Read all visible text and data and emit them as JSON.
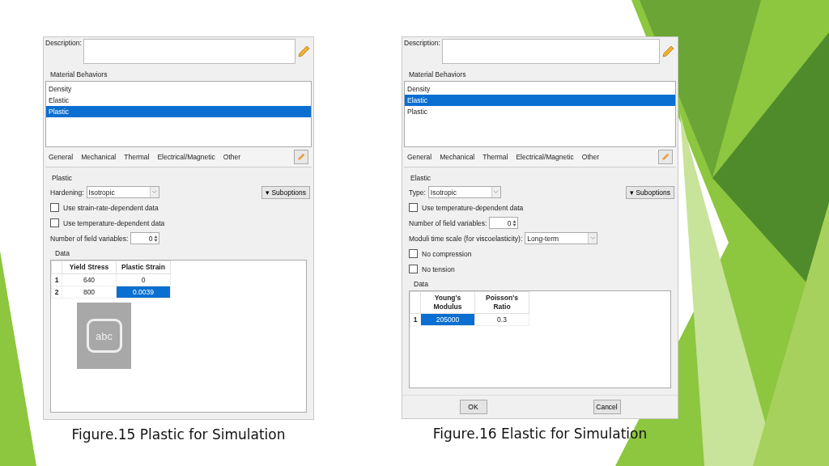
{
  "figures": [
    {
      "caption": "Figure.15 Plastic for Simulation",
      "dialog": {
        "description_label": "Description:",
        "behaviors_label": "Material Behaviors",
        "behaviors": [
          {
            "label": "Density",
            "selected": false
          },
          {
            "label": "Elastic",
            "selected": false
          },
          {
            "label": "Plastic",
            "selected": true
          }
        ],
        "menu": [
          "General",
          "Mechanical",
          "Thermal",
          "Electrical/Magnetic",
          "Other"
        ],
        "section_title": "Plastic",
        "suboptions": "▾ Suboptions",
        "options": [
          {
            "kind": "select",
            "label": "Hardening:",
            "value": "Isotropic"
          },
          {
            "kind": "checkbox",
            "label": "Use strain-rate-dependent data",
            "checked": false
          },
          {
            "kind": "checkbox",
            "label": "Use temperature-dependent data",
            "checked": false
          },
          {
            "kind": "spinner",
            "label": "Number of field variables:",
            "value": "0"
          }
        ],
        "data_label": "Data",
        "table": {
          "columns": [
            "Yield Stress",
            "Plastic Strain"
          ],
          "rows": [
            {
              "index": "1",
              "cells": [
                {
                  "text": "640",
                  "selected": false
                },
                {
                  "text": "0",
                  "selected": false
                }
              ]
            },
            {
              "index": "2",
              "cells": [
                {
                  "text": "800",
                  "selected": false
                },
                {
                  "text": "0.0039",
                  "selected": true
                }
              ]
            }
          ]
        },
        "overlay": {
          "label": "abc"
        }
      }
    },
    {
      "caption": "Figure.16 Elastic for Simulation",
      "dialog": {
        "description_label": "Description:",
        "behaviors_label": "Material Behaviors",
        "behaviors": [
          {
            "label": "Density",
            "selected": false
          },
          {
            "label": "Elastic",
            "selected": true
          },
          {
            "label": "Plastic",
            "selected": false
          }
        ],
        "menu": [
          "General",
          "Mechanical",
          "Thermal",
          "Electrical/Magnetic",
          "Other"
        ],
        "section_title": "Elastic",
        "suboptions": "▾ Suboptions",
        "options": [
          {
            "kind": "select",
            "label": "Type:",
            "value": "Isotropic"
          },
          {
            "kind": "checkbox",
            "label": "Use temperature-dependent data",
            "checked": false
          },
          {
            "kind": "spinner",
            "label": "Number of field variables:",
            "value": "0"
          },
          {
            "kind": "select",
            "label": "Moduli time scale (for viscoelasticity):",
            "value": "Long-term"
          },
          {
            "kind": "checkbox",
            "label": "No compression",
            "checked": false
          },
          {
            "kind": "checkbox",
            "label": "No tension",
            "checked": false
          }
        ],
        "data_label": "Data",
        "table": {
          "columns": [
            "Young's Modulus",
            "Poisson's Ratio"
          ],
          "rows": [
            {
              "index": "1",
              "cells": [
                {
                  "text": "205000",
                  "selected": true
                },
                {
                  "text": "0.3",
                  "selected": false
                }
              ]
            }
          ]
        },
        "buttons": [
          "OK",
          "Cancel"
        ]
      }
    }
  ]
}
